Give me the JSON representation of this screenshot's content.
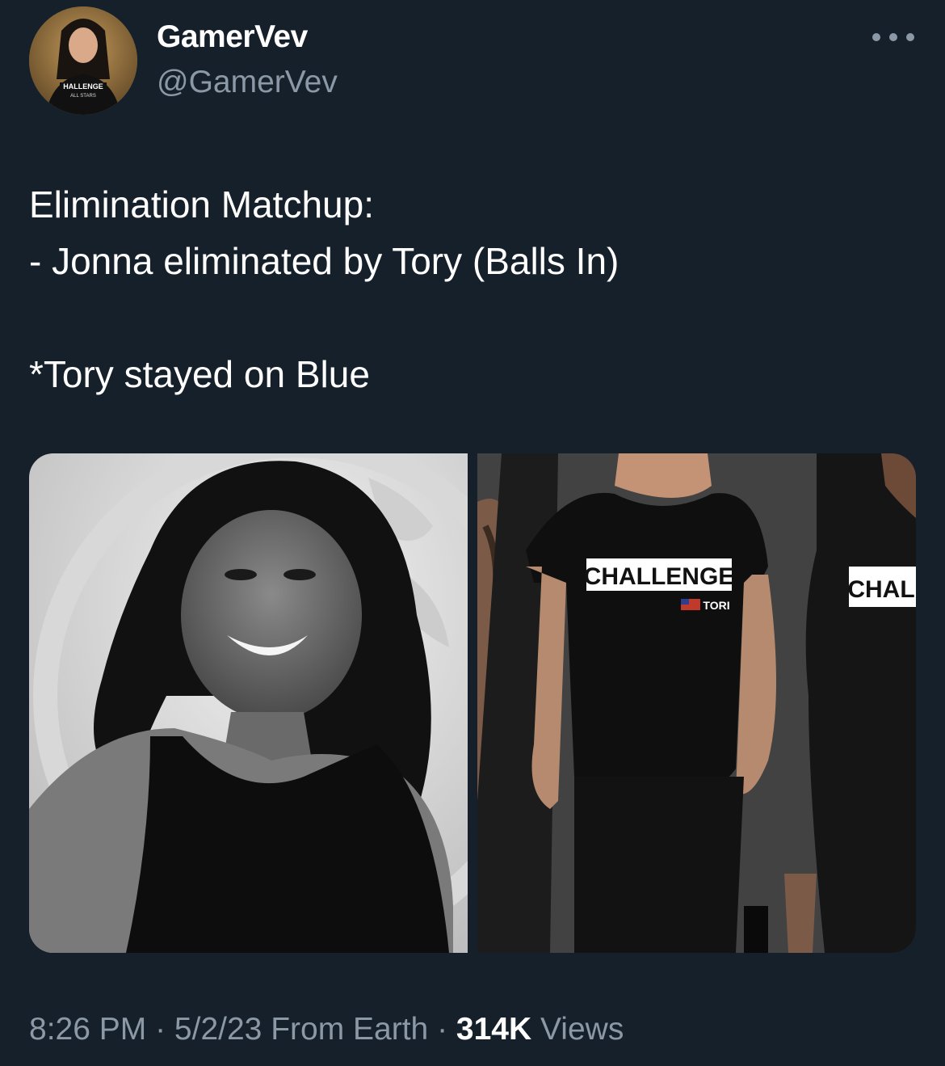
{
  "author": {
    "display_name": "GamerVev",
    "handle": "@GamerVev",
    "avatar_caption": "CHALLENGE ALL STARS"
  },
  "tweet": {
    "line1": "Elimination Matchup:",
    "line2": "- Jonna eliminated by Tory (Balls In)",
    "line3": "*Tory stayed on Blue"
  },
  "media": {
    "left_description": "black and white portrait photo",
    "right_shirt_text": "CHALLENGE",
    "right_shirt_subtext": "TORI",
    "right_shirt_text_partial": "CHAL"
  },
  "meta": {
    "time": "8:26 PM",
    "separator": " · ",
    "date": "5/2/23",
    "source": "From Earth",
    "views_count": "314K",
    "views_label": "Views"
  },
  "colors": {
    "background": "#15202b",
    "secondary_text": "#8b98a5",
    "primary_text": "#ffffff"
  },
  "icons": {
    "more": "more-horizontal-icon"
  }
}
